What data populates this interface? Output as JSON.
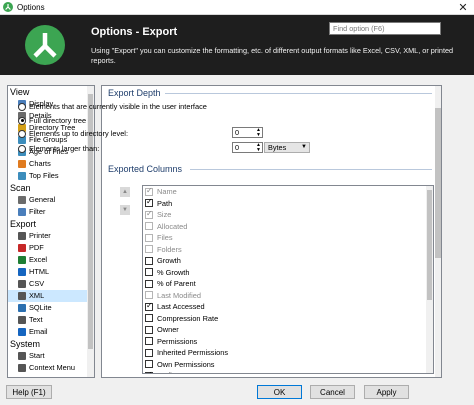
{
  "window": {
    "title": "Options",
    "close_symbol": "✕"
  },
  "header": {
    "title": "Options - Export",
    "description": "Using \"Export\" you can customize the formatting, etc. of different output formats like Excel, CSV, XML, or printed reports.",
    "search_placeholder": "Find option (F6)"
  },
  "sidebar": {
    "sections": [
      {
        "label": "View",
        "items": [
          {
            "label": "Display",
            "icon": "display-icon"
          },
          {
            "label": "Details",
            "icon": "details-icon"
          },
          {
            "label": "Directory Tree",
            "icon": "directory-tree-icon"
          },
          {
            "label": "File Groups",
            "icon": "file-groups-icon"
          },
          {
            "label": "Age of Files",
            "icon": "age-of-files-icon"
          },
          {
            "label": "Charts",
            "icon": "charts-icon"
          },
          {
            "label": "Top Files",
            "icon": "top-files-icon"
          }
        ]
      },
      {
        "label": "Scan",
        "items": [
          {
            "label": "General",
            "icon": "gear-icon"
          },
          {
            "label": "Filter",
            "icon": "filter-icon"
          }
        ]
      },
      {
        "label": "Export",
        "items": [
          {
            "label": "Printer",
            "icon": "printer-icon"
          },
          {
            "label": "PDF",
            "icon": "pdf-icon"
          },
          {
            "label": "Excel",
            "icon": "excel-icon"
          },
          {
            "label": "HTML",
            "icon": "html-icon"
          },
          {
            "label": "CSV",
            "icon": "csv-icon"
          },
          {
            "label": "XML",
            "icon": "xml-icon",
            "selected": true
          },
          {
            "label": "SQLite",
            "icon": "sqlite-icon"
          },
          {
            "label": "Text",
            "icon": "text-icon"
          },
          {
            "label": "Email",
            "icon": "email-icon"
          }
        ]
      },
      {
        "label": "System",
        "items": [
          {
            "label": "Start",
            "icon": "start-icon"
          },
          {
            "label": "Context Menu",
            "icon": "context-menu-icon"
          }
        ]
      }
    ]
  },
  "export_depth": {
    "title": "Export Depth",
    "options": [
      {
        "label": "Elements that are currently visible in the user interface",
        "selected": false
      },
      {
        "label": "Full directory tree",
        "selected": true
      },
      {
        "label": "Elements up to directory level:",
        "selected": false
      },
      {
        "label": "Elements larger than:",
        "selected": false
      }
    ],
    "level_value": "0",
    "size_value": "0",
    "size_unit": "Bytes"
  },
  "exported_columns": {
    "title": "Exported Columns",
    "items": [
      {
        "label": "Name",
        "checked": true,
        "disabled": true
      },
      {
        "label": "Path",
        "checked": true,
        "disabled": false
      },
      {
        "label": "Size",
        "checked": true,
        "disabled": true
      },
      {
        "label": "Allocated",
        "checked": false,
        "disabled": true
      },
      {
        "label": "Files",
        "checked": false,
        "disabled": true
      },
      {
        "label": "Folders",
        "checked": false,
        "disabled": true
      },
      {
        "label": "Growth",
        "checked": false,
        "disabled": false
      },
      {
        "label": "% Growth",
        "checked": false,
        "disabled": false
      },
      {
        "label": "% of Parent",
        "checked": false,
        "disabled": false
      },
      {
        "label": "Last Modified",
        "checked": false,
        "disabled": true
      },
      {
        "label": "Last Accessed",
        "checked": true,
        "disabled": false
      },
      {
        "label": "Compression Rate",
        "checked": false,
        "disabled": false
      },
      {
        "label": "Owner",
        "checked": false,
        "disabled": false
      },
      {
        "label": "Permissions",
        "checked": false,
        "disabled": false
      },
      {
        "label": "Inherited Permissions",
        "checked": false,
        "disabled": false
      },
      {
        "label": "Own Permissions",
        "checked": false,
        "disabled": false
      },
      {
        "label": "Attributes",
        "checked": true,
        "disabled": false
      }
    ]
  },
  "buttons": {
    "help": "Help (F1)",
    "ok": "OK",
    "cancel": "Cancel",
    "apply": "Apply"
  },
  "colors": {
    "accent": "#0078d7",
    "logo_green": "#3ca552",
    "header_bg": "#1e1e1e",
    "selection": "#cce8ff"
  }
}
